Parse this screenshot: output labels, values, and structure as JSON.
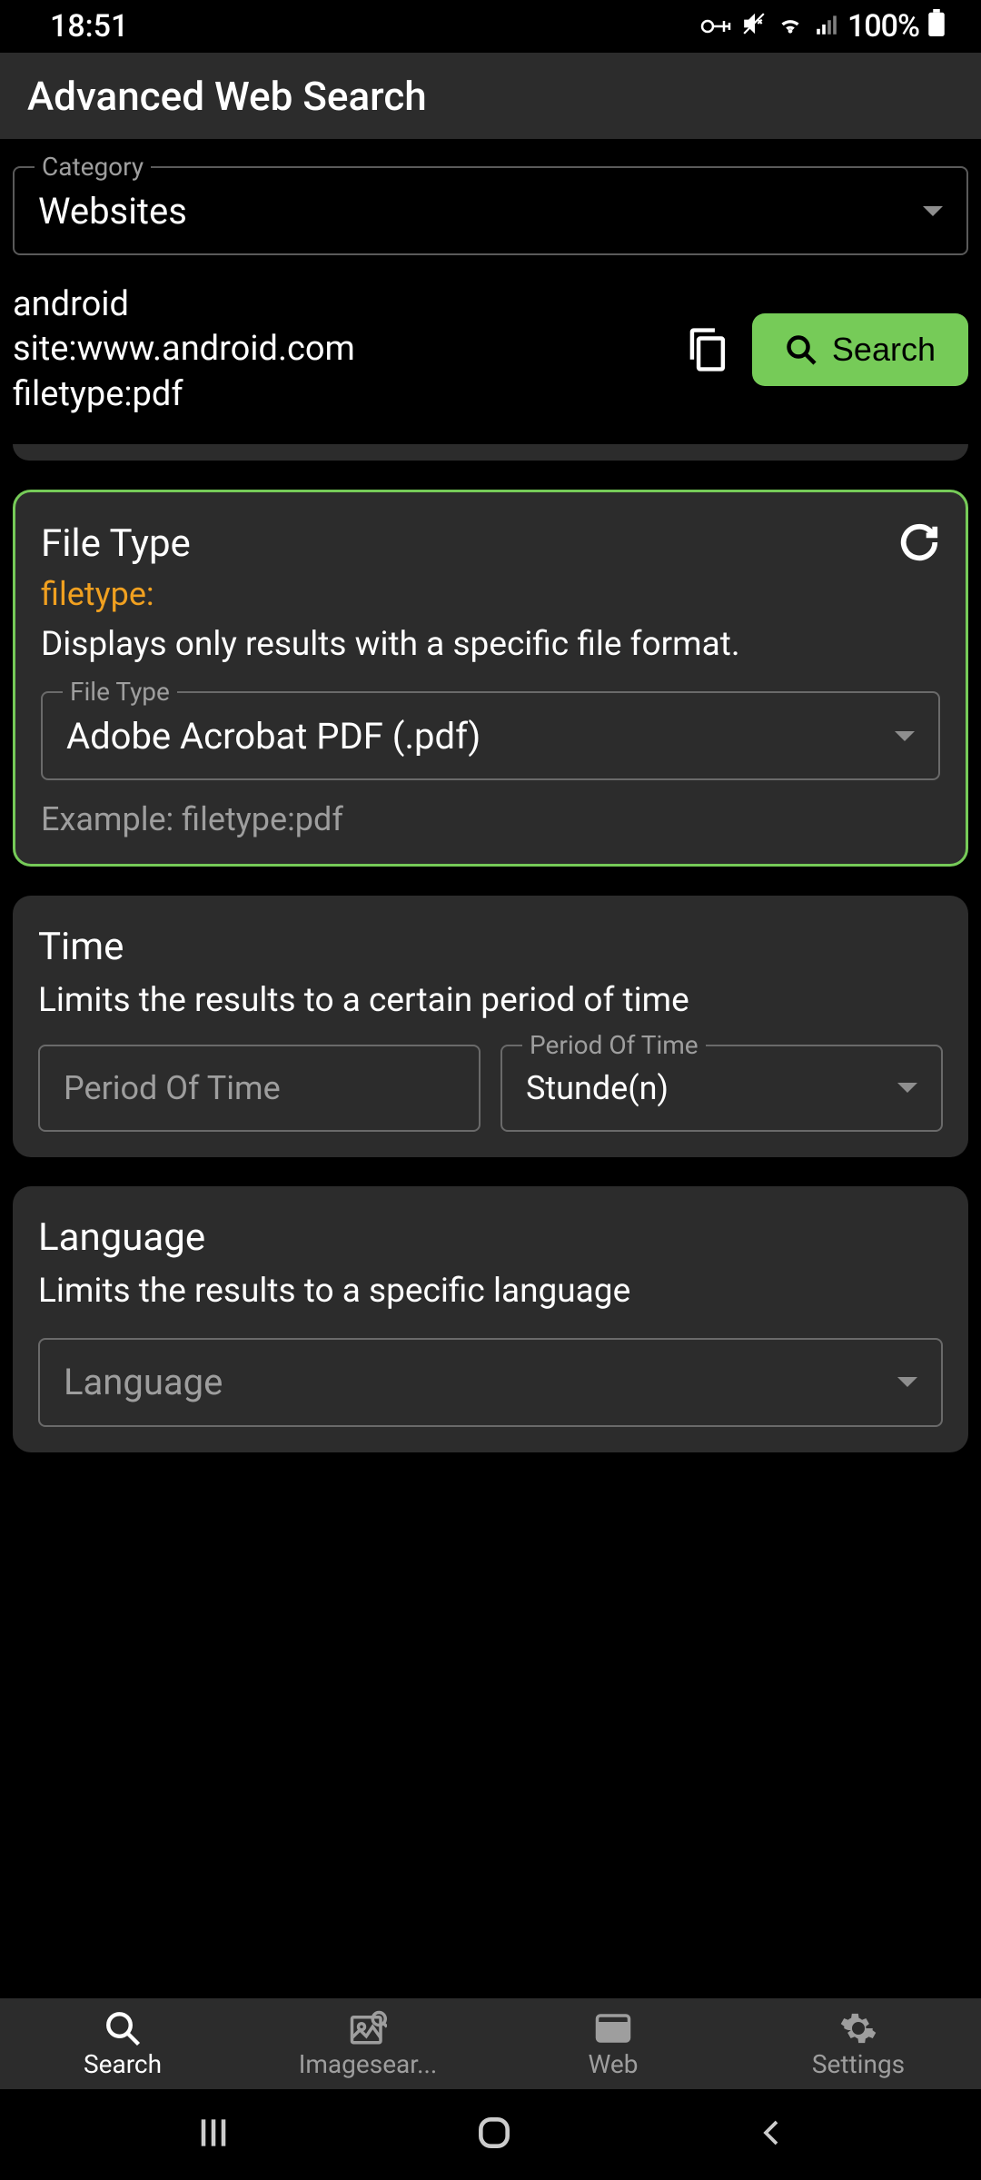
{
  "status": {
    "time": "18:51",
    "battery": "100%"
  },
  "appbar": {
    "title": "Advanced Web Search"
  },
  "category": {
    "label": "Category",
    "value": "Websites"
  },
  "query": {
    "line1": "android",
    "line2": "site:www.android.com",
    "line3": "filetype:pdf"
  },
  "search_button": "Search",
  "filetype": {
    "title": "File Type",
    "operator": "filetype:",
    "description": "Displays only results with a specific file format.",
    "field_label": "File Type",
    "value": "Adobe Acrobat PDF (.pdf)",
    "example": "Example: filetype:pdf"
  },
  "time": {
    "title": "Time",
    "description": "Limits the results to a certain period of time",
    "field1_placeholder": "Period Of Time",
    "field2_label": "Period Of Time",
    "field2_value": "Stunde(n)"
  },
  "language": {
    "title": "Language",
    "description": "Limits the results to a specific language",
    "placeholder": "Language"
  },
  "nav": {
    "search": "Search",
    "image": "Imagesear...",
    "web": "Web",
    "settings": "Settings"
  }
}
